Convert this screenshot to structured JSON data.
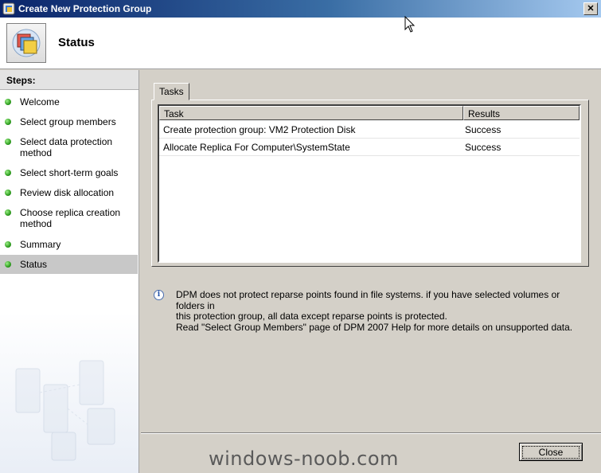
{
  "window": {
    "title": "Create New Protection Group",
    "close_glyph": "✕"
  },
  "header": {
    "title": "Status"
  },
  "steps": {
    "heading": "Steps:",
    "items": [
      {
        "label": "Welcome",
        "state": "done"
      },
      {
        "label": "Select group members",
        "state": "done"
      },
      {
        "label": "Select data protection method",
        "state": "done"
      },
      {
        "label": "Select short-term goals",
        "state": "done"
      },
      {
        "label": "Review disk allocation",
        "state": "done"
      },
      {
        "label": "Choose replica creation method",
        "state": "done"
      },
      {
        "label": "Summary",
        "state": "done"
      },
      {
        "label": "Status",
        "state": "current"
      }
    ]
  },
  "tabs": [
    {
      "label": "Tasks",
      "selected": true
    }
  ],
  "tasks_table": {
    "columns": [
      "Task",
      "Results"
    ],
    "rows": [
      {
        "task": "Create protection group: VM2 Protection Disk",
        "result": "Success"
      },
      {
        "task": "Allocate Replica For Computer\\SystemState",
        "result": "Success"
      }
    ]
  },
  "info": {
    "icon_glyph": "i",
    "line1": "DPM does not protect reparse points found in file systems. if you have selected volumes or folders in",
    "line2": "this protection group, all data except reparse points is protected.",
    "line3": "Read \"Select Group Members\" page of DPM 2007 Help for more details on unsupported data."
  },
  "buttons": {
    "close_label": "Close"
  },
  "watermark": "windows-noob.com",
  "colors": {
    "titlebar_start": "#0a246a",
    "titlebar_end": "#a6caf0",
    "step_done": "#2f9e1f",
    "dialog_face": "#d4d0c8"
  },
  "icons": {
    "app": "protection-group-icon",
    "header": "protection-group-large-icon",
    "info": "info-icon",
    "step": "status-dot-icon"
  }
}
